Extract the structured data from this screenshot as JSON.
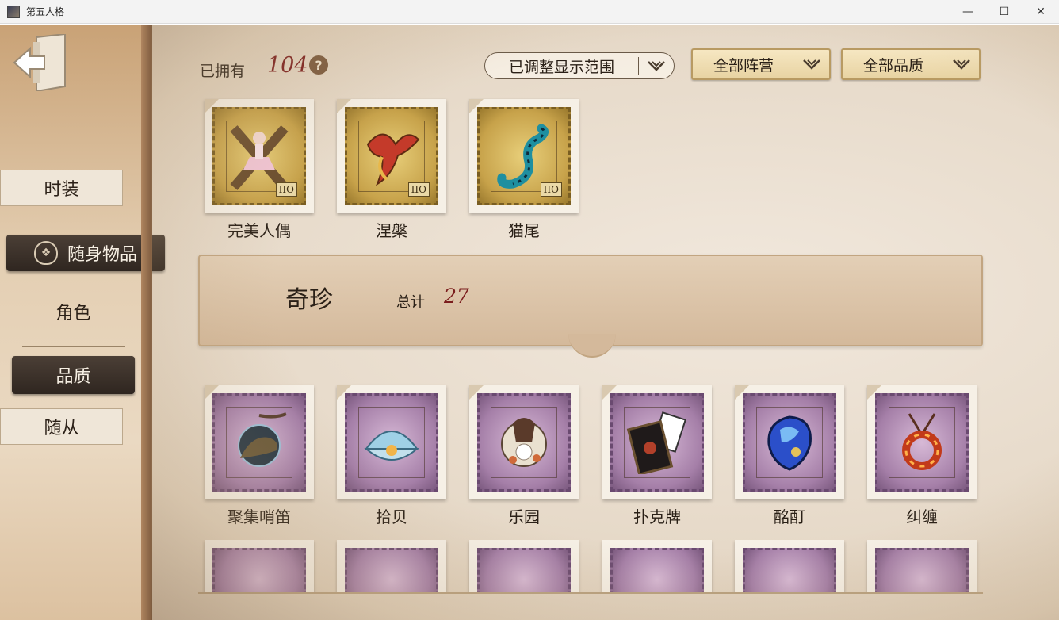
{
  "window": {
    "title": "第五人格",
    "minimize": "—",
    "maximize": "☐",
    "close": "✕"
  },
  "sidebar": {
    "tabs": [
      {
        "label": "时装"
      },
      {
        "label": "随身物品"
      },
      {
        "label": "角色"
      },
      {
        "label": "品质"
      },
      {
        "label": "随从"
      }
    ]
  },
  "header": {
    "owned_label": "已拥有",
    "owned_count": "104",
    "help": "?",
    "range_dropdown": "已调整显示范围",
    "camp_dropdown": "全部阵营",
    "quality_dropdown": "全部品质"
  },
  "top_items": [
    {
      "name": "完美人偶",
      "tag": "IIO"
    },
    {
      "name": "涅槃",
      "tag": "IIO"
    },
    {
      "name": "猫尾",
      "tag": "IIO"
    }
  ],
  "banner": {
    "title": "奇珍",
    "total_label": "总计",
    "total": "27"
  },
  "rare_items": [
    {
      "name": "聚集哨笛"
    },
    {
      "name": "拾贝"
    },
    {
      "name": "乐园"
    },
    {
      "name": "扑克牌"
    },
    {
      "name": "酩酊"
    },
    {
      "name": "纠缠"
    }
  ],
  "colors": {
    "accent_red": "#7b1d1d",
    "gold_stamp": "#c7a24a",
    "purple_stamp": "#a57fa8"
  }
}
